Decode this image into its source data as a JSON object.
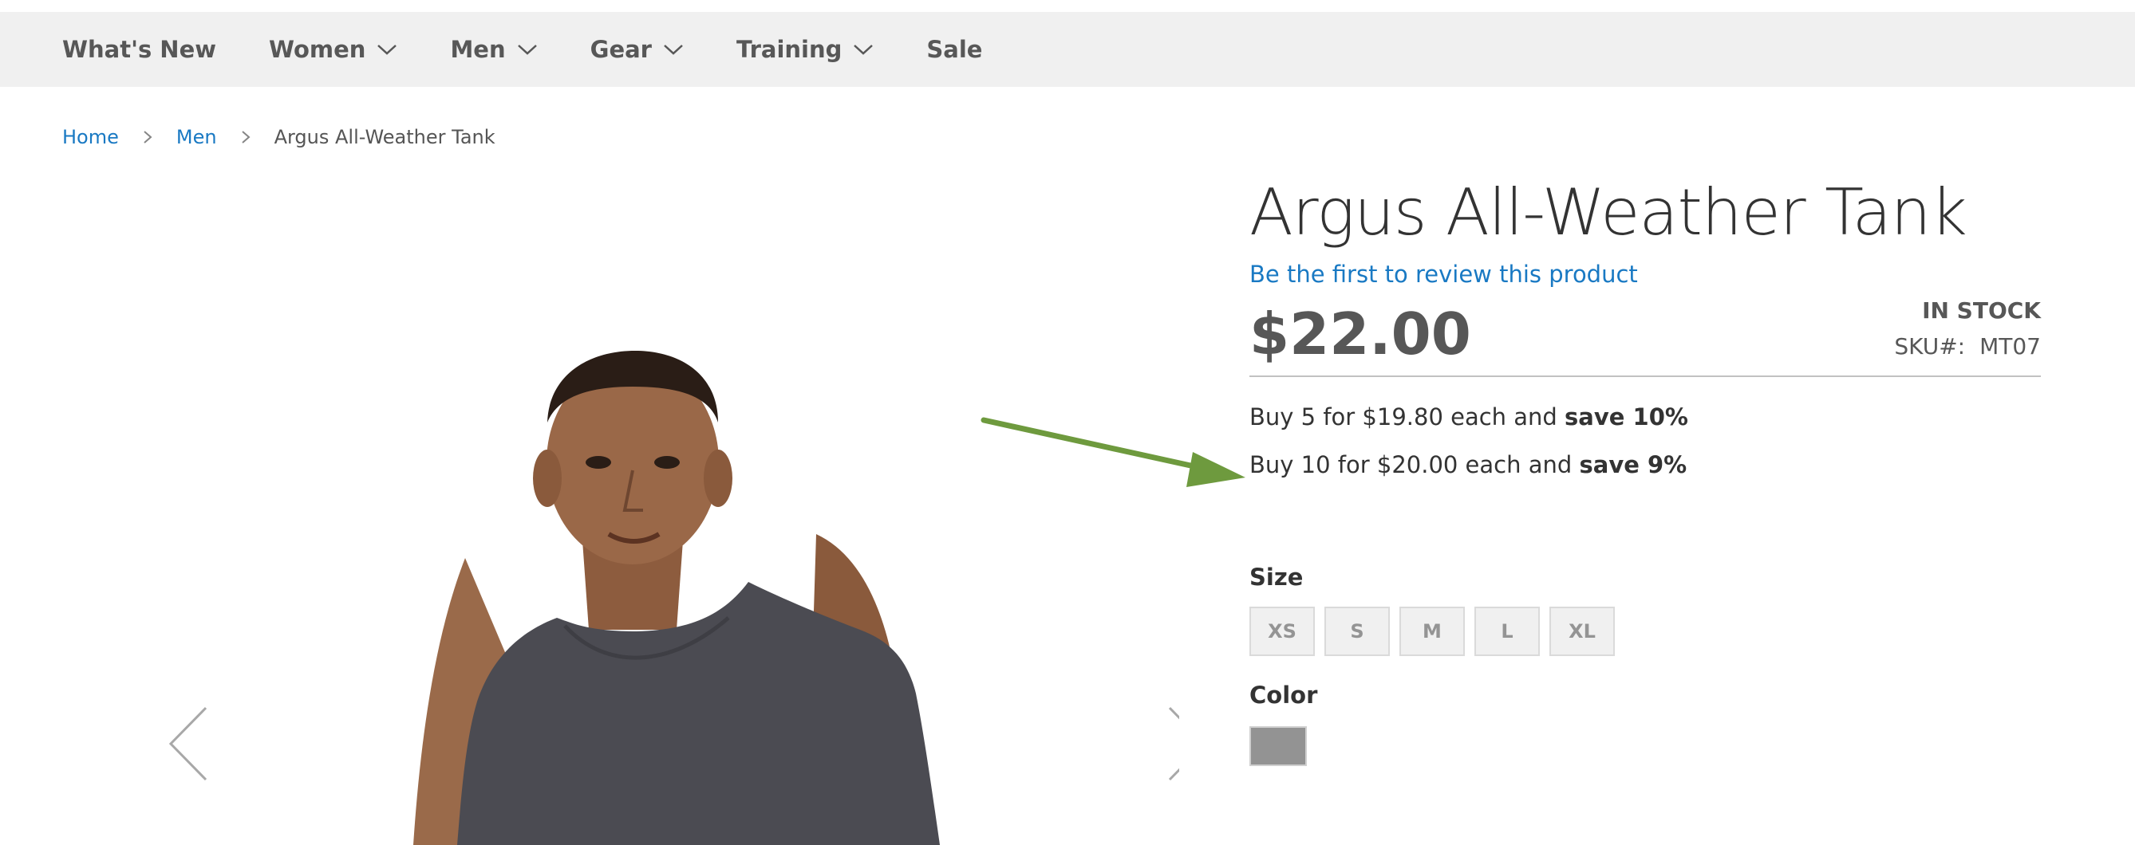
{
  "nav": {
    "items": [
      {
        "label": "What's New"
      },
      {
        "label": "Women"
      },
      {
        "label": "Men"
      },
      {
        "label": "Gear"
      },
      {
        "label": "Training"
      },
      {
        "label": "Sale"
      }
    ]
  },
  "breadcrumb": {
    "home": "Home",
    "category": "Men",
    "current": "Argus All-Weather Tank"
  },
  "product": {
    "title": "Argus All-Weather Tank",
    "review_link": "Be the first to review this product",
    "price": "$22.00",
    "stock_status": "IN STOCK",
    "sku_label": "SKU#:",
    "sku": "MT07",
    "tiers": [
      {
        "text": "Buy 5 for $19.80 each and ",
        "save": "save 10%"
      },
      {
        "text": "Buy 10 for $20.00 each and ",
        "save": "save 9%"
      }
    ],
    "size_label": "Size",
    "sizes": [
      "XS",
      "S",
      "M",
      "L",
      "XL"
    ],
    "color_label": "Color",
    "color_swatch": "#939393"
  },
  "colors": {
    "nav_bg": "#f0f0f0",
    "link": "#1979c3",
    "annotation_arrow": "#6e9a3e",
    "shirt": "#4b4b52"
  },
  "icons": {
    "nav_dropdown": "chevron-down-icon",
    "breadcrumb_separator": "chevron-right-icon",
    "gallery_prev": "chevron-left-icon",
    "gallery_next": "chevron-right-icon"
  }
}
